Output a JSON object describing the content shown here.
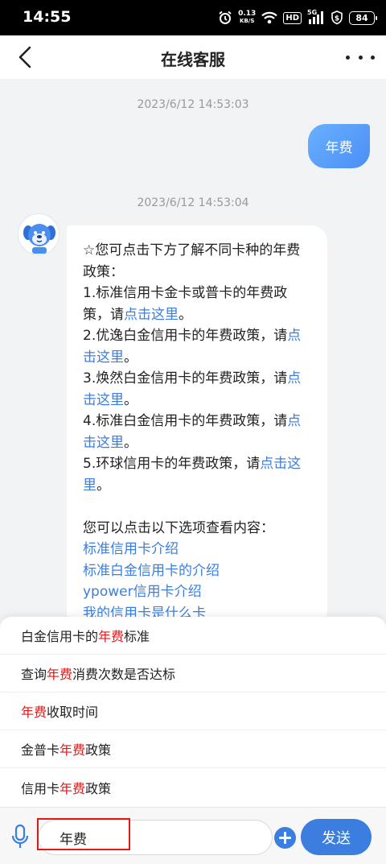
{
  "status_bar": {
    "time": "14:55",
    "net_speed_value": "0.13",
    "net_speed_unit": "KB/S",
    "hd_label": "HD",
    "signal_label": "5G",
    "battery": "84"
  },
  "header": {
    "title": "在线客服"
  },
  "chat": {
    "time1": "2023/6/12 14:53:03",
    "user_message": "年费",
    "time2": "2023/6/12 14:53:04",
    "bot": {
      "l1": "☆您可点击下方了解不同卡种的年费",
      "l2": "政策：",
      "l3": "1.标准信用卡金卡或普卡的年费政",
      "l4_text": "策，请",
      "l4_link": "点击这里",
      "l4_end": "。",
      "l5_text": "2.优逸白金信用卡的年费政策，请",
      "l5_link": "点",
      "l6_link": "击这里",
      "l6_end": "。",
      "l7_text": "3.焕然白金信用卡的年费政策，请",
      "l7_link": "点",
      "l8_link": "击这里",
      "l8_end": "。",
      "l9_text": "4.标准白金信用卡的年费政策，请",
      "l9_link": "点",
      "l10_link": "击这里",
      "l10_end": "。",
      "l11_text": "5.环球信用卡的年费政策，请",
      "l11_link": "点击这",
      "l12_link": "里",
      "l12_end": "。",
      "options_intro": "您可以点击以下选项查看内容：",
      "options": [
        "标准信用卡介绍",
        "标准白金信用卡的介绍",
        "ypower信用卡介绍",
        "我的信用卡是什么卡"
      ]
    }
  },
  "suggestions": [
    {
      "pre": "白金信用卡的",
      "kw": "年费",
      "post": "标准"
    },
    {
      "pre": "查询",
      "kw": "年费",
      "post": "消费次数是否达标"
    },
    {
      "pre": "",
      "kw": "年费",
      "post": "收取时间"
    },
    {
      "pre": "金普卡",
      "kw": "年费",
      "post": "政策"
    },
    {
      "pre": "信用卡",
      "kw": "年费",
      "post": "政策"
    }
  ],
  "input_bar": {
    "value": "年费",
    "send_label": "发送"
  },
  "colors": {
    "accent": "#3b7ee0",
    "keyword": "#e01818",
    "background": "#f2f3f5"
  }
}
